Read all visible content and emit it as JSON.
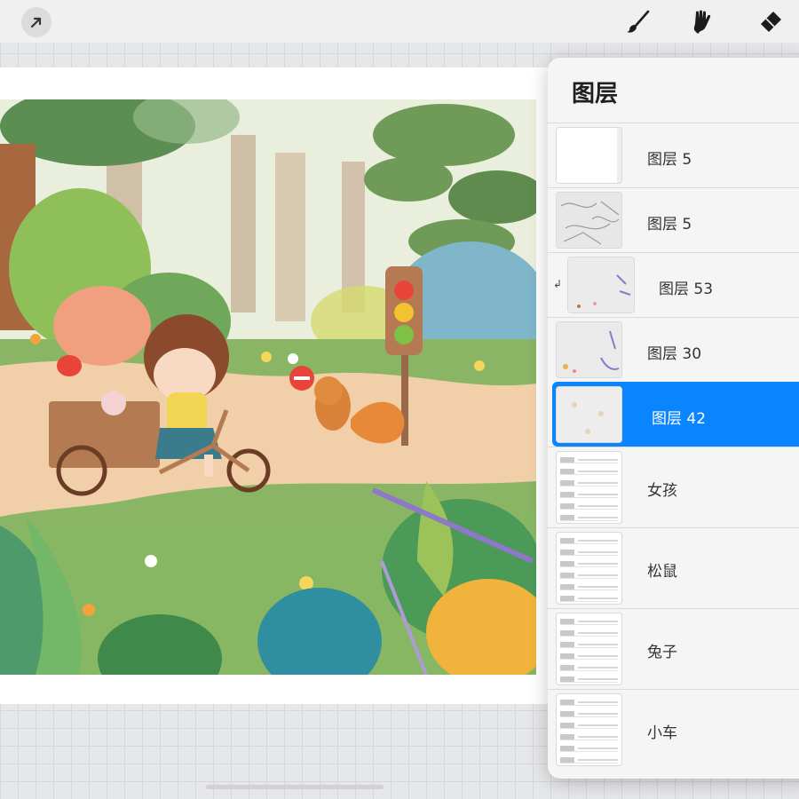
{
  "toolbar": {
    "tools": [
      {
        "name": "brush-icon"
      },
      {
        "name": "smudge-icon"
      },
      {
        "name": "eraser-icon"
      }
    ]
  },
  "layers_panel": {
    "title": "图层",
    "layers": [
      {
        "name": "图层 5"
      },
      {
        "name": "图层 5"
      },
      {
        "name": "图层 53"
      },
      {
        "name": "图层 30"
      },
      {
        "name": "图层 42"
      },
      {
        "name": "女孩"
      },
      {
        "name": "松鼠"
      },
      {
        "name": "兔子"
      },
      {
        "name": "小车"
      }
    ]
  },
  "colors": {
    "selected": "#0a84ff",
    "panel": "#f5f5f6",
    "grid": "#e6e7e9"
  }
}
